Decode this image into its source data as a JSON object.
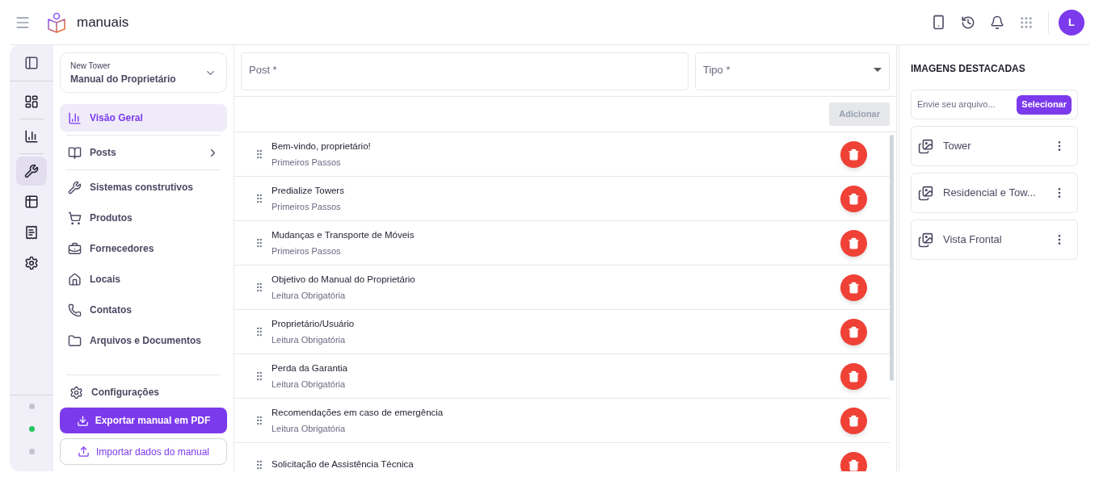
{
  "app": {
    "name": "manuais",
    "avatar": "L"
  },
  "rail": {
    "items": [
      {
        "selected": false
      },
      {
        "selected": false
      },
      {
        "selected": true
      },
      {
        "selected": false
      },
      {
        "selected": false
      },
      {
        "selected": false
      }
    ],
    "dots": [
      {
        "color": "#c4c2d0"
      },
      {
        "color": "#22c55e"
      },
      {
        "color": "#c4c2d0"
      }
    ]
  },
  "project": {
    "label": "New Tower",
    "value": "Manual do Proprietário"
  },
  "nav": [
    {
      "label": "Visão Geral",
      "selected": true,
      "submenu": false
    },
    {
      "label": "Posts",
      "selected": false,
      "submenu": true
    },
    {
      "label": "Sistemas construtivos",
      "selected": false,
      "submenu": false
    },
    {
      "label": "Produtos",
      "selected": false,
      "submenu": false
    },
    {
      "label": "Fornecedores",
      "selected": false,
      "submenu": false
    },
    {
      "label": "Locais",
      "selected": false,
      "submenu": false
    },
    {
      "label": "Contatos",
      "selected": false,
      "submenu": false
    },
    {
      "label": "Arquivos e Documentos",
      "selected": false,
      "submenu": false
    }
  ],
  "settings": "Configurações",
  "export_button": "Exportar manual em PDF",
  "import_button": "Importar dados do manual",
  "form": {
    "post": {
      "placeholder": "Post *"
    },
    "tipo": {
      "placeholder": "Tipo *"
    },
    "add_button": {
      "label": "Adicionar",
      "disabled": true
    }
  },
  "posts": [
    {
      "title": "Bem-vindo, proprietário!",
      "category": "Primeiros Passos"
    },
    {
      "title": "Predialize Towers",
      "category": "Primeiros Passos"
    },
    {
      "title": "Mudanças e Transporte de Móveis",
      "category": "Primeiros Passos"
    },
    {
      "title": "Objetivo do Manual do Proprietário",
      "category": "Leitura Obrigatória"
    },
    {
      "title": "Proprietário/Usuário",
      "category": "Leitura Obrigatória"
    },
    {
      "title": "Perda da Garantia",
      "category": "Leitura Obrigatória"
    },
    {
      "title": "Recomendações em caso de emergência",
      "category": "Leitura Obrigatória"
    },
    {
      "title": "Solicitação de Assistência Técnica"
    }
  ],
  "images": {
    "title": "IMAGENS DESTACADAS",
    "upload": {
      "placeholder": "Envie seu arquivo...",
      "button": "Selecionar"
    },
    "items": [
      {
        "name": "Tower"
      },
      {
        "name": "Residencial e Tow..."
      },
      {
        "name": "Vista Frontal"
      }
    ]
  }
}
